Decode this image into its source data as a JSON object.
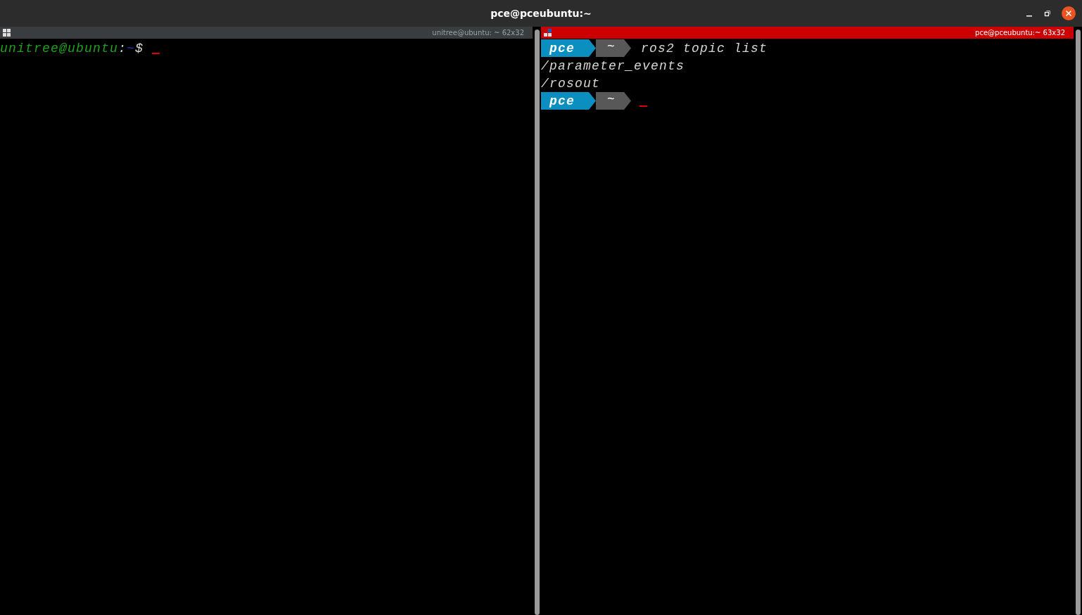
{
  "window": {
    "title": "pce@pceubuntu:~"
  },
  "panes": [
    {
      "title": "unitree@ubuntu: ~ 62x32",
      "selected": false,
      "lines": [
        {
          "kind": "bash_prompt",
          "user_host": "unitree@ubuntu",
          "separator": ":",
          "path": "~",
          "symbol": "$",
          "cursor": true
        }
      ]
    },
    {
      "title": "pce@pceubuntu:~ 63x32",
      "selected": true,
      "lines": [
        {
          "kind": "powerline_prompt",
          "user": "pce",
          "path": "~",
          "command": "ros2 topic list"
        },
        {
          "kind": "output",
          "text": "/parameter_events"
        },
        {
          "kind": "output",
          "text": "/rosout"
        },
        {
          "kind": "powerline_prompt",
          "user": "pce",
          "path": "~",
          "cursor": true
        }
      ]
    }
  ]
}
